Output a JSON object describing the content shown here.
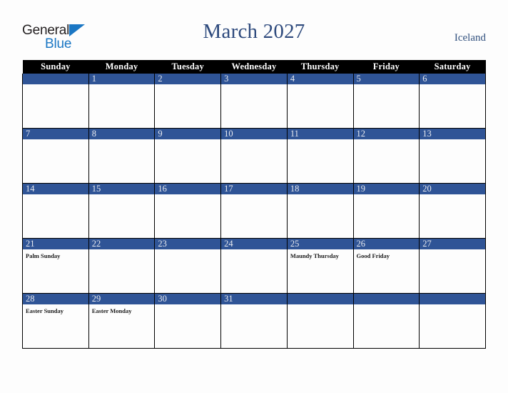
{
  "brand": {
    "name_part1": "General",
    "name_part2": "Blue"
  },
  "header": {
    "title": "March 2027",
    "region": "Iceland"
  },
  "calendar": {
    "weekday_headers": [
      "Sunday",
      "Monday",
      "Tuesday",
      "Wednesday",
      "Thursday",
      "Friday",
      "Saturday"
    ],
    "colors": {
      "header_bar": "#000000",
      "date_bar": "#2f5496",
      "title_text": "#2e4a7d",
      "brand_blue": "#1b77c4",
      "cell_background": "#fdfdfd"
    },
    "weeks": [
      [
        {
          "day": "",
          "event": ""
        },
        {
          "day": "1",
          "event": ""
        },
        {
          "day": "2",
          "event": ""
        },
        {
          "day": "3",
          "event": ""
        },
        {
          "day": "4",
          "event": ""
        },
        {
          "day": "5",
          "event": ""
        },
        {
          "day": "6",
          "event": ""
        }
      ],
      [
        {
          "day": "7",
          "event": ""
        },
        {
          "day": "8",
          "event": ""
        },
        {
          "day": "9",
          "event": ""
        },
        {
          "day": "10",
          "event": ""
        },
        {
          "day": "11",
          "event": ""
        },
        {
          "day": "12",
          "event": ""
        },
        {
          "day": "13",
          "event": ""
        }
      ],
      [
        {
          "day": "14",
          "event": ""
        },
        {
          "day": "15",
          "event": ""
        },
        {
          "day": "16",
          "event": ""
        },
        {
          "day": "17",
          "event": ""
        },
        {
          "day": "18",
          "event": ""
        },
        {
          "day": "19",
          "event": ""
        },
        {
          "day": "20",
          "event": ""
        }
      ],
      [
        {
          "day": "21",
          "event": "Palm Sunday"
        },
        {
          "day": "22",
          "event": ""
        },
        {
          "day": "23",
          "event": ""
        },
        {
          "day": "24",
          "event": ""
        },
        {
          "day": "25",
          "event": "Maundy Thursday"
        },
        {
          "day": "26",
          "event": "Good Friday"
        },
        {
          "day": "27",
          "event": ""
        }
      ],
      [
        {
          "day": "28",
          "event": "Easter Sunday"
        },
        {
          "day": "29",
          "event": "Easter Monday"
        },
        {
          "day": "30",
          "event": ""
        },
        {
          "day": "31",
          "event": ""
        },
        {
          "day": "",
          "event": ""
        },
        {
          "day": "",
          "event": ""
        },
        {
          "day": "",
          "event": ""
        }
      ]
    ]
  }
}
